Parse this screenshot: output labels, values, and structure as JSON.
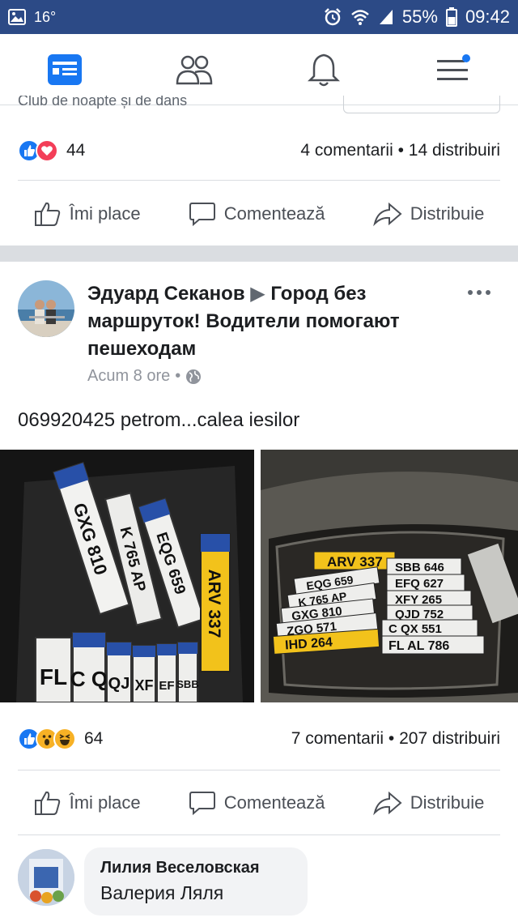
{
  "status_bar": {
    "temperature": "16°",
    "battery": "55%",
    "time": "09:42"
  },
  "nav": {
    "items": [
      {
        "icon": "news-feed-icon",
        "active": true
      },
      {
        "icon": "friends-icon",
        "active": false
      },
      {
        "icon": "notifications-bell-icon",
        "active": false
      },
      {
        "icon": "menu-icon",
        "active": false
      }
    ]
  },
  "partial_prev": {
    "text": "Club de noapte și de dans"
  },
  "post1": {
    "reaction_count": "44",
    "stats": "4 comentarii • 14 distribuiri",
    "actions": {
      "like": "Îmi place",
      "comment": "Comentează",
      "share": "Distribuie"
    }
  },
  "post2": {
    "author": "Эдуард Секанов",
    "group": "Город без маршруток! Водители помогают пешеходам",
    "time": "Acum 8 ore",
    "text": "069920425 petrom...calea iesilor",
    "reaction_count": "64",
    "stats": "7 comentarii • 207 distribuiri",
    "actions": {
      "like": "Îmi place",
      "comment": "Comentează",
      "share": "Distribuie"
    },
    "plates_left": [
      "GXG 810",
      "K 765 AP",
      "EQG 659",
      "ARV 337",
      "FL",
      "C Q",
      "QJ",
      "XF",
      "EF",
      "SBB"
    ],
    "plates_right": [
      "ARV 337",
      "SBB 646",
      "EQG 659",
      "EFQ 627",
      "K 765 AP",
      "XFY 265",
      "GXG 810",
      "QJD 752",
      "ZGO 571",
      "C QX 551",
      "IHD 264",
      "FL AL 786"
    ]
  },
  "comment": {
    "author": "Лилия Веселовская",
    "text": "Валерия Ляля"
  },
  "colors": {
    "status_bar": "#2c4a86",
    "fb_blue": "#1877f2",
    "divider": "#dadde1"
  }
}
